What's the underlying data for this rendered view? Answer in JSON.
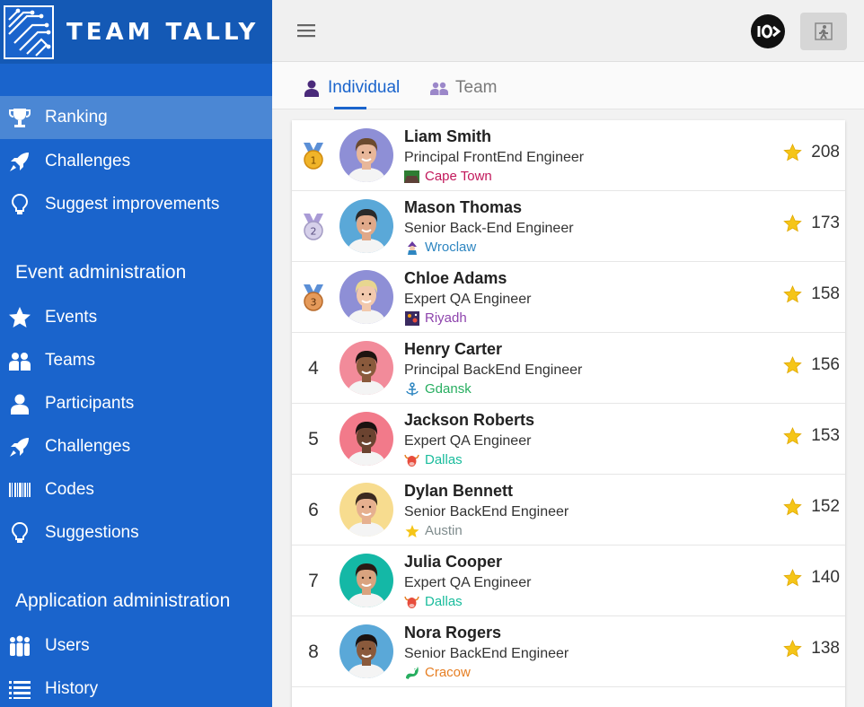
{
  "brand": {
    "name": "TEAM TALLY"
  },
  "sidebar": {
    "top_items": [
      {
        "label": "Ranking",
        "icon": "trophy-icon",
        "active": true
      },
      {
        "label": "Challenges",
        "icon": "rocket-icon",
        "active": false
      },
      {
        "label": "Suggest improvements",
        "icon": "lightbulb-icon",
        "active": false
      }
    ],
    "event_admin": {
      "title": "Event administration",
      "items": [
        {
          "label": "Events",
          "icon": "star-icon"
        },
        {
          "label": "Teams",
          "icon": "team-icon"
        },
        {
          "label": "Participants",
          "icon": "user-icon"
        },
        {
          "label": "Challenges",
          "icon": "rocket-icon"
        },
        {
          "label": "Codes",
          "icon": "barcode-icon"
        },
        {
          "label": "Suggestions",
          "icon": "lightbulb-icon"
        }
      ]
    },
    "app_admin": {
      "title": "Application administration",
      "items": [
        {
          "label": "Users",
          "icon": "users-icon"
        },
        {
          "label": "History",
          "icon": "list-icon"
        }
      ]
    }
  },
  "topbar": {
    "menu_icon": "hamburger-icon",
    "brand_icon": "brand-circle-icon",
    "logout_icon": "exit-icon"
  },
  "tabs": [
    {
      "label": "Individual",
      "icon": "person-icon",
      "active": true
    },
    {
      "label": "Team",
      "icon": "group-icon",
      "active": false
    }
  ],
  "ranking": [
    {
      "rank": "1",
      "medal": "gold",
      "name": "Liam Smith",
      "role": "Principal FrontEnd Engineer",
      "location": "Cape Town",
      "location_color": "#c2185b",
      "location_icon": "table-mountain-icon",
      "score": "208",
      "avatar_bg": "#8e8fd6",
      "skin": "#e8b79a",
      "hair": "#6b4a2e"
    },
    {
      "rank": "2",
      "medal": "silver",
      "name": "Mason Thomas",
      "role": "Senior Back-End Engineer",
      "location": "Wroclaw",
      "location_color": "#2e86c1",
      "location_icon": "dwarf-icon",
      "score": "173",
      "avatar_bg": "#5aa8d8",
      "skin": "#e0a98a",
      "hair": "#2a2a2a"
    },
    {
      "rank": "3",
      "medal": "bronze",
      "name": "Chloe Adams",
      "role": "Expert QA Engineer",
      "location": "Riyadh",
      "location_color": "#8e44ad",
      "location_icon": "fireworks-icon",
      "score": "158",
      "avatar_bg": "#8e8fd6",
      "skin": "#f2c9ad",
      "hair": "#e8d690"
    },
    {
      "rank": "4",
      "medal": "",
      "name": "Henry Carter",
      "role": "Principal BackEnd Engineer",
      "location": "Gdansk",
      "location_color": "#27ae60",
      "location_icon": "anchor-icon",
      "score": "156",
      "avatar_bg": "#f28b9a",
      "skin": "#8a5a3c",
      "hair": "#1e1410"
    },
    {
      "rank": "5",
      "medal": "",
      "name": "Jackson Roberts",
      "role": "Expert QA Engineer",
      "location": "Dallas",
      "location_color": "#1abc9c",
      "location_icon": "bull-icon",
      "score": "153",
      "avatar_bg": "#f27a8a",
      "skin": "#6b4330",
      "hair": "#1a1210"
    },
    {
      "rank": "6",
      "medal": "",
      "name": "Dylan Bennett",
      "role": "Senior BackEnd Engineer",
      "location": "Austin",
      "location_color": "#7f8c8d",
      "location_icon": "star-loc-icon",
      "score": "152",
      "avatar_bg": "#f7dc8f",
      "skin": "#e6b08f",
      "hair": "#3b2a20"
    },
    {
      "rank": "7",
      "medal": "",
      "name": "Julia Cooper",
      "role": "Expert QA Engineer",
      "location": "Dallas",
      "location_color": "#1abc9c",
      "location_icon": "bull-icon",
      "score": "140",
      "avatar_bg": "#14b8a6",
      "skin": "#d9a37f",
      "hair": "#2a1a14"
    },
    {
      "rank": "8",
      "medal": "",
      "name": "Nora Rogers",
      "role": "Senior BackEnd Engineer",
      "location": "Cracow",
      "location_color": "#e67e22",
      "location_icon": "dragon-icon",
      "score": "138",
      "avatar_bg": "#5aa8d8",
      "skin": "#8a5a3c",
      "hair": "#1a1210"
    }
  ]
}
